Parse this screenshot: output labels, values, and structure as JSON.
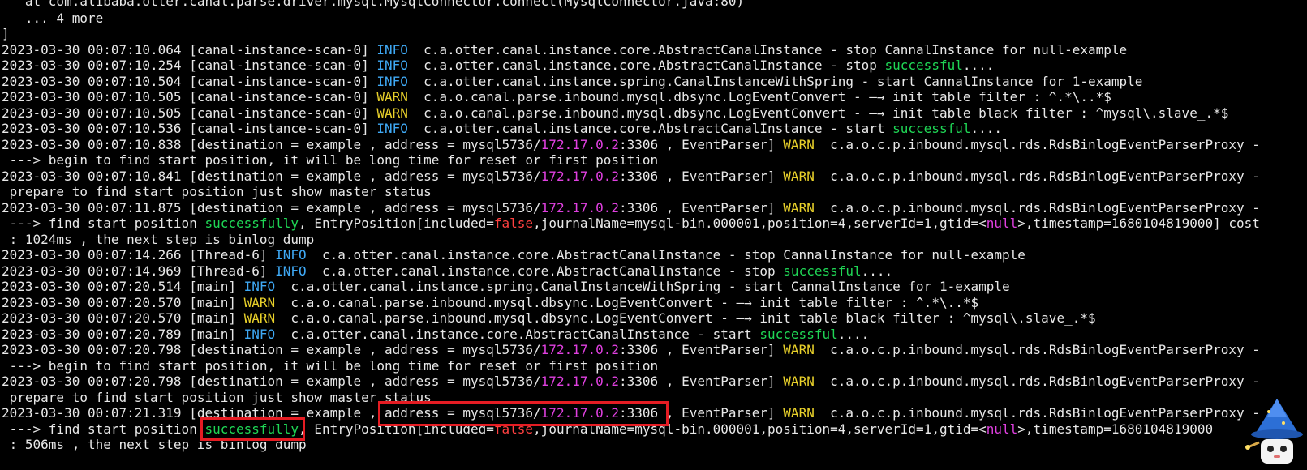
{
  "terminal": {
    "lines": [
      {
        "segments": [
          {
            "text": "   at com.alibaba.otter.canal.parse.driver.mysql.MysqlConnector.connect(MysqlConnector.java:80)",
            "color": "default"
          }
        ]
      },
      {
        "segments": [
          {
            "text": "   ... 4 more",
            "color": "default"
          }
        ]
      },
      {
        "segments": [
          {
            "text": "]",
            "color": "default"
          }
        ]
      },
      {
        "segments": [
          {
            "text": "2023-03-30 00:07:10.064 [canal-instance-scan-0] ",
            "color": "default"
          },
          {
            "text": "INFO",
            "color": "info"
          },
          {
            "text": "  c.a.otter.canal.instance.core.AbstractCanalInstance - stop CannalInstance for null-example",
            "color": "default"
          }
        ]
      },
      {
        "segments": [
          {
            "text": "2023-03-30 00:07:10.254 [canal-instance-scan-0] ",
            "color": "default"
          },
          {
            "text": "INFO",
            "color": "info"
          },
          {
            "text": "  c.a.otter.canal.instance.core.AbstractCanalInstance - stop ",
            "color": "default"
          },
          {
            "text": "successful",
            "color": "ok"
          },
          {
            "text": "....",
            "color": "default"
          }
        ]
      },
      {
        "segments": [
          {
            "text": "2023-03-30 00:07:10.504 [canal-instance-scan-0] ",
            "color": "default"
          },
          {
            "text": "INFO",
            "color": "info"
          },
          {
            "text": "  c.a.otter.canal.instance.spring.CanalInstanceWithSpring - start CannalInstance for 1-example",
            "color": "default"
          }
        ]
      },
      {
        "segments": [
          {
            "text": "2023-03-30 00:07:10.505 [canal-instance-scan-0] ",
            "color": "default"
          },
          {
            "text": "WARN",
            "color": "warn"
          },
          {
            "text": "  c.a.o.canal.parse.inbound.mysql.dbsync.LogEventConvert - —→ init table filter : ^.*\\..*$",
            "color": "default"
          }
        ]
      },
      {
        "segments": [
          {
            "text": "2023-03-30 00:07:10.505 [canal-instance-scan-0] ",
            "color": "default"
          },
          {
            "text": "WARN",
            "color": "warn"
          },
          {
            "text": "  c.a.o.canal.parse.inbound.mysql.dbsync.LogEventConvert - —→ init table black filter : ^mysql\\.slave_.*$",
            "color": "default"
          }
        ]
      },
      {
        "segments": [
          {
            "text": "2023-03-30 00:07:10.536 [canal-instance-scan-0] ",
            "color": "default"
          },
          {
            "text": "INFO",
            "color": "info"
          },
          {
            "text": "  c.a.otter.canal.instance.core.AbstractCanalInstance - start ",
            "color": "default"
          },
          {
            "text": "successful",
            "color": "ok"
          },
          {
            "text": "....",
            "color": "default"
          }
        ]
      },
      {
        "segments": [
          {
            "text": "2023-03-30 00:07:10.838 [destination = example , address = mysql5736/",
            "color": "default"
          },
          {
            "text": "172.17.0.2",
            "color": "ip"
          },
          {
            "text": ":3306 , EventParser] ",
            "color": "default"
          },
          {
            "text": "WARN",
            "color": "warn"
          },
          {
            "text": "  c.a.o.c.p.inbound.mysql.rds.RdsBinlogEventParserProxy -",
            "color": "default"
          }
        ]
      },
      {
        "segments": [
          {
            "text": " ---> begin to find start position, it will be long time for reset or first position",
            "color": "default"
          }
        ]
      },
      {
        "segments": [
          {
            "text": "2023-03-30 00:07:10.841 [destination = example , address = mysql5736/",
            "color": "default"
          },
          {
            "text": "172.17.0.2",
            "color": "ip"
          },
          {
            "text": ":3306 , EventParser] ",
            "color": "default"
          },
          {
            "text": "WARN",
            "color": "warn"
          },
          {
            "text": "  c.a.o.c.p.inbound.mysql.rds.RdsBinlogEventParserProxy -",
            "color": "default"
          }
        ]
      },
      {
        "segments": [
          {
            "text": " prepare to find start position just show master status",
            "color": "default"
          }
        ]
      },
      {
        "segments": [
          {
            "text": "2023-03-30 00:07:11.875 [destination = example , address = mysql5736/",
            "color": "default"
          },
          {
            "text": "172.17.0.2",
            "color": "ip"
          },
          {
            "text": ":3306 , EventParser] ",
            "color": "default"
          },
          {
            "text": "WARN",
            "color": "warn"
          },
          {
            "text": "  c.a.o.c.p.inbound.mysql.rds.RdsBinlogEventParserProxy -",
            "color": "default"
          }
        ]
      },
      {
        "segments": [
          {
            "text": " ---> find start position ",
            "color": "default"
          },
          {
            "text": "successfully",
            "color": "ok"
          },
          {
            "text": ", EntryPosition[included=",
            "color": "default"
          },
          {
            "text": "false",
            "color": "false"
          },
          {
            "text": ",journalName=mysql-bin.000001,position=4,serverId=1,gtid=<",
            "color": "default"
          },
          {
            "text": "null",
            "color": "null"
          },
          {
            "text": ">,timestamp=1680104819000] cost",
            "color": "default"
          }
        ]
      },
      {
        "segments": [
          {
            "text": " : 1024ms , the next step is binlog dump",
            "color": "default"
          }
        ]
      },
      {
        "segments": [
          {
            "text": "2023-03-30 00:07:14.266 [Thread-6] ",
            "color": "default"
          },
          {
            "text": "INFO",
            "color": "info"
          },
          {
            "text": "  c.a.otter.canal.instance.core.AbstractCanalInstance - stop CannalInstance for null-example",
            "color": "default"
          }
        ]
      },
      {
        "segments": [
          {
            "text": "2023-03-30 00:07:14.969 [Thread-6] ",
            "color": "default"
          },
          {
            "text": "INFO",
            "color": "info"
          },
          {
            "text": "  c.a.otter.canal.instance.core.AbstractCanalInstance - stop ",
            "color": "default"
          },
          {
            "text": "successful",
            "color": "ok"
          },
          {
            "text": "....",
            "color": "default"
          }
        ]
      },
      {
        "segments": [
          {
            "text": "2023-03-30 00:07:20.514 [main] ",
            "color": "default"
          },
          {
            "text": "INFO",
            "color": "info"
          },
          {
            "text": "  c.a.otter.canal.instance.spring.CanalInstanceWithSpring - start CannalInstance for 1-example",
            "color": "default"
          }
        ]
      },
      {
        "segments": [
          {
            "text": "2023-03-30 00:07:20.570 [main] ",
            "color": "default"
          },
          {
            "text": "WARN",
            "color": "warn"
          },
          {
            "text": "  c.a.o.canal.parse.inbound.mysql.dbsync.LogEventConvert - —→ init table filter : ^.*\\..*$",
            "color": "default"
          }
        ]
      },
      {
        "segments": [
          {
            "text": "2023-03-30 00:07:20.570 [main] ",
            "color": "default"
          },
          {
            "text": "WARN",
            "color": "warn"
          },
          {
            "text": "  c.a.o.canal.parse.inbound.mysql.dbsync.LogEventConvert - —→ init table black filter : ^mysql\\.slave_.*$",
            "color": "default"
          }
        ]
      },
      {
        "segments": [
          {
            "text": "2023-03-30 00:07:20.789 [main] ",
            "color": "default"
          },
          {
            "text": "INFO",
            "color": "info"
          },
          {
            "text": "  c.a.otter.canal.instance.core.AbstractCanalInstance - start ",
            "color": "default"
          },
          {
            "text": "successful",
            "color": "ok"
          },
          {
            "text": "....",
            "color": "default"
          }
        ]
      },
      {
        "segments": [
          {
            "text": "2023-03-30 00:07:20.798 [destination = example , address = mysql5736/",
            "color": "default"
          },
          {
            "text": "172.17.0.2",
            "color": "ip"
          },
          {
            "text": ":3306 , EventParser] ",
            "color": "default"
          },
          {
            "text": "WARN",
            "color": "warn"
          },
          {
            "text": "  c.a.o.c.p.inbound.mysql.rds.RdsBinlogEventParserProxy -",
            "color": "default"
          }
        ]
      },
      {
        "segments": [
          {
            "text": " ---> begin to find start position, it will be long time for reset or first position",
            "color": "default"
          }
        ]
      },
      {
        "segments": [
          {
            "text": "2023-03-30 00:07:20.798 [destination = example , address = mysql5736/",
            "color": "default"
          },
          {
            "text": "172.17.0.2",
            "color": "ip"
          },
          {
            "text": ":3306 , EventParser] ",
            "color": "default"
          },
          {
            "text": "WARN",
            "color": "warn"
          },
          {
            "text": "  c.a.o.c.p.inbound.mysql.rds.RdsBinlogEventParserProxy -",
            "color": "default"
          }
        ]
      },
      {
        "segments": [
          {
            "text": " prepare to find start position just show master status",
            "color": "default"
          }
        ]
      },
      {
        "segments": [
          {
            "text": "2023-03-30 00:07:21.319 [destination = example , address = mysql5736/",
            "color": "default"
          },
          {
            "text": "172.17.0.2",
            "color": "ip"
          },
          {
            "text": ":3306 , EventParser] ",
            "color": "default"
          },
          {
            "text": "WARN",
            "color": "warn"
          },
          {
            "text": "  c.a.o.c.p.inbound.mysql.rds.RdsBinlogEventParserProxy -",
            "color": "default"
          }
        ]
      },
      {
        "segments": [
          {
            "text": " ---> find start position ",
            "color": "default"
          },
          {
            "text": "successfully",
            "color": "ok"
          },
          {
            "text": ", EntryPosition[included=",
            "color": "default"
          },
          {
            "text": "false",
            "color": "false"
          },
          {
            "text": ",journalName=mysql-bin.000001,position=4,serverId=1,gtid=<",
            "color": "default"
          },
          {
            "text": "null",
            "color": "null"
          },
          {
            "text": ">,timestamp=1680104819000",
            "color": "default"
          }
        ]
      },
      {
        "segments": [
          {
            "text": " : 506ms , the next step is binlog dump",
            "color": "default"
          }
        ]
      }
    ]
  },
  "colors": {
    "background": "#000000",
    "default": "#e8e8e8",
    "info": "#3fa9f5",
    "warn": "#e8d02a",
    "ok": "#1fd655",
    "ip": "#e040e0",
    "false": "#ff4040",
    "null": "#e040e0",
    "highlight": "#e51c23"
  }
}
